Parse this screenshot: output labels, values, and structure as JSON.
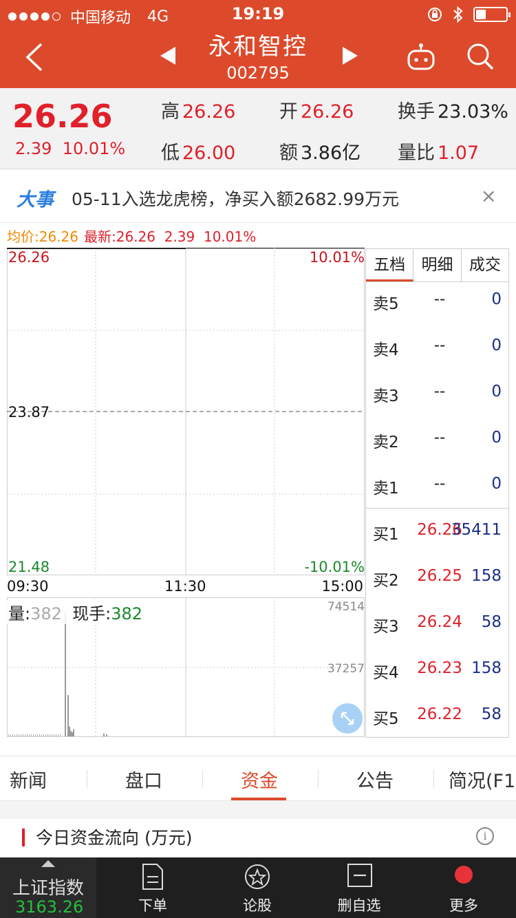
{
  "status_bar": {
    "carrier": "中国移动",
    "network": "4G",
    "time": "19:19"
  },
  "nav": {
    "title": "永和智控",
    "code": "002795",
    "icons": [
      "back-icon",
      "prev-arrow-icon",
      "next-arrow-icon",
      "robot-icon",
      "search-icon"
    ]
  },
  "quote": {
    "price": "26.26",
    "change": "2.39",
    "change_pct": "10.01%",
    "high_label": "高",
    "high": "26.26",
    "open_label": "开",
    "open": "26.26",
    "turnover_label": "换手",
    "turnover": "23.03%",
    "low_label": "低",
    "low": "26.00",
    "amount_label": "额",
    "amount": "3.86亿",
    "volratio_label": "量比",
    "volratio": "1.07"
  },
  "event": {
    "tag": "大事",
    "text": "05-11入选龙虎榜，净买入额2682.99万元",
    "close": "×"
  },
  "avg_line": {
    "avg": "均价:26.26",
    "latest": "最新:26.26",
    "change": "2.39",
    "pct": "10.01%"
  },
  "chart": {
    "top_price": "26.26",
    "top_pct": "10.01%",
    "mid_price": "23.87",
    "bottom_price": "21.48",
    "bottom_pct": "-10.01%",
    "time_start": "09:30",
    "time_mid": "11:30",
    "time_end": "15:00",
    "vol_label": "量:",
    "vol_value": "382",
    "hand_label": "现手:",
    "hand_value": "382",
    "vol_max": "74514",
    "vol_mid": "37257"
  },
  "chart_data": {
    "type": "line",
    "x": [
      "09:30",
      "11:30",
      "15:00"
    ],
    "series": [
      {
        "values": [
          26.26,
          26.26,
          26.26
        ]
      }
    ],
    "ylim": [
      21.48,
      26.26
    ],
    "reference_y": 23.87,
    "volume_ylim": [
      0,
      74514
    ]
  },
  "order_book": {
    "tabs": [
      "五档",
      "明细",
      "成交"
    ],
    "active_tab": 0,
    "asks": [
      {
        "label": "卖5",
        "price": "--",
        "qty": "0"
      },
      {
        "label": "卖4",
        "price": "--",
        "qty": "0"
      },
      {
        "label": "卖3",
        "price": "--",
        "qty": "0"
      },
      {
        "label": "卖2",
        "price": "--",
        "qty": "0"
      },
      {
        "label": "卖1",
        "price": "--",
        "qty": "0"
      }
    ],
    "bids": [
      {
        "label": "买1",
        "price": "26.26",
        "qty": "35411"
      },
      {
        "label": "买2",
        "price": "26.25",
        "qty": "158"
      },
      {
        "label": "买3",
        "price": "26.24",
        "qty": "58"
      },
      {
        "label": "买4",
        "price": "26.23",
        "qty": "158"
      },
      {
        "label": "买5",
        "price": "26.22",
        "qty": "58"
      }
    ]
  },
  "tabs": [
    {
      "label": "新闻"
    },
    {
      "label": "盘口"
    },
    {
      "label": "资金"
    },
    {
      "label": "公告"
    },
    {
      "label": "简况(F1"
    }
  ],
  "fund_flow": {
    "title": "今日资金流向 (万元)",
    "info": "i"
  },
  "bottom_bar": {
    "index_name": "上证指数",
    "index_value": "3163.26",
    "items": [
      {
        "label": "下单",
        "icon": "order-icon"
      },
      {
        "label": "论股",
        "icon": "star-chat-icon"
      },
      {
        "label": "删自选",
        "icon": "remove-watchlist-icon"
      },
      {
        "label": "更多",
        "icon": "more-icon"
      }
    ]
  },
  "colors": {
    "brand": "#dc4a2b",
    "up": "#e0202a",
    "down": "#1a8a2a",
    "bid_qty": "#1a2f8a"
  }
}
